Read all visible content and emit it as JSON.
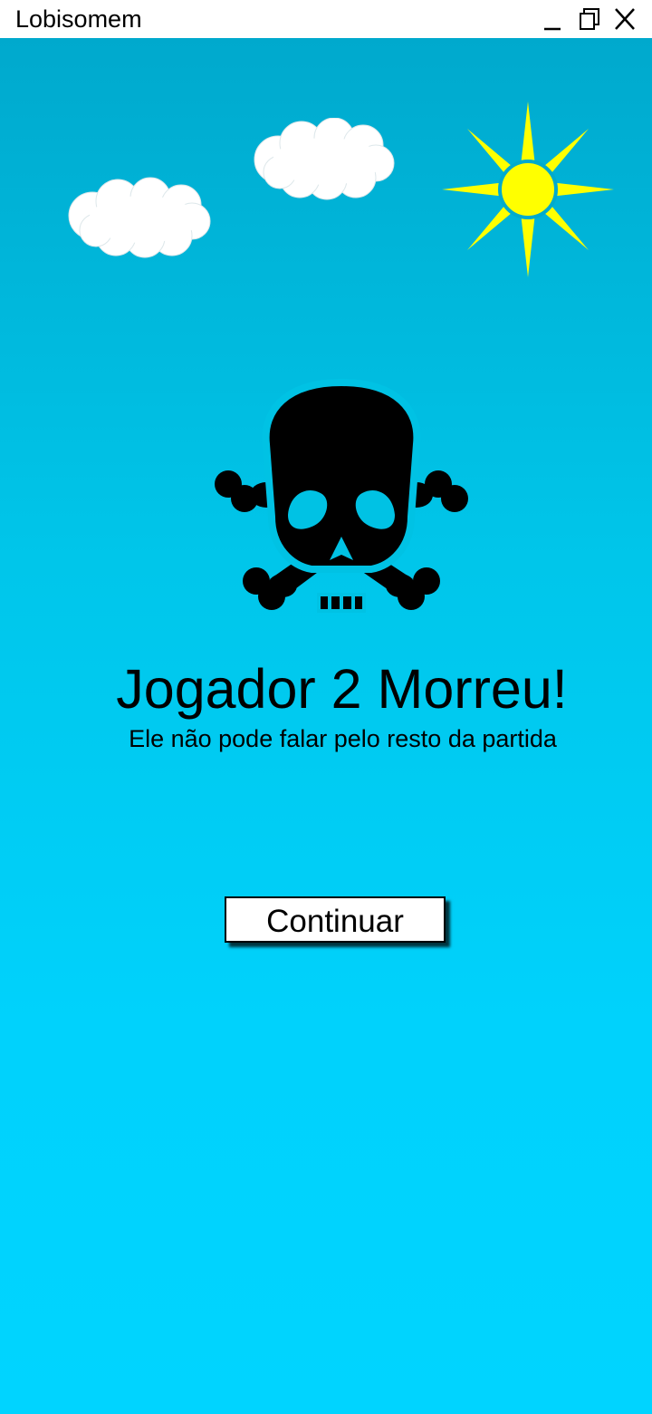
{
  "window": {
    "title": "Lobisomem",
    "controls": [
      "minimize-icon",
      "restore-icon",
      "close-icon"
    ]
  },
  "scene": {
    "sky_top_color": "#00a9cd",
    "sky_bottom_color": "#00d4ff",
    "sun_color": "#ffff00",
    "cloud_color": "#ffffff",
    "decorations": [
      "cloud-icon",
      "cloud-icon",
      "sun-icon",
      "skull-crossbones-icon"
    ]
  },
  "death_message": {
    "headline": "Jogador 2 Morreu!",
    "subtitle": "Ele não pode falar pelo resto da partida"
  },
  "actions": {
    "continue_label": "Continuar"
  }
}
